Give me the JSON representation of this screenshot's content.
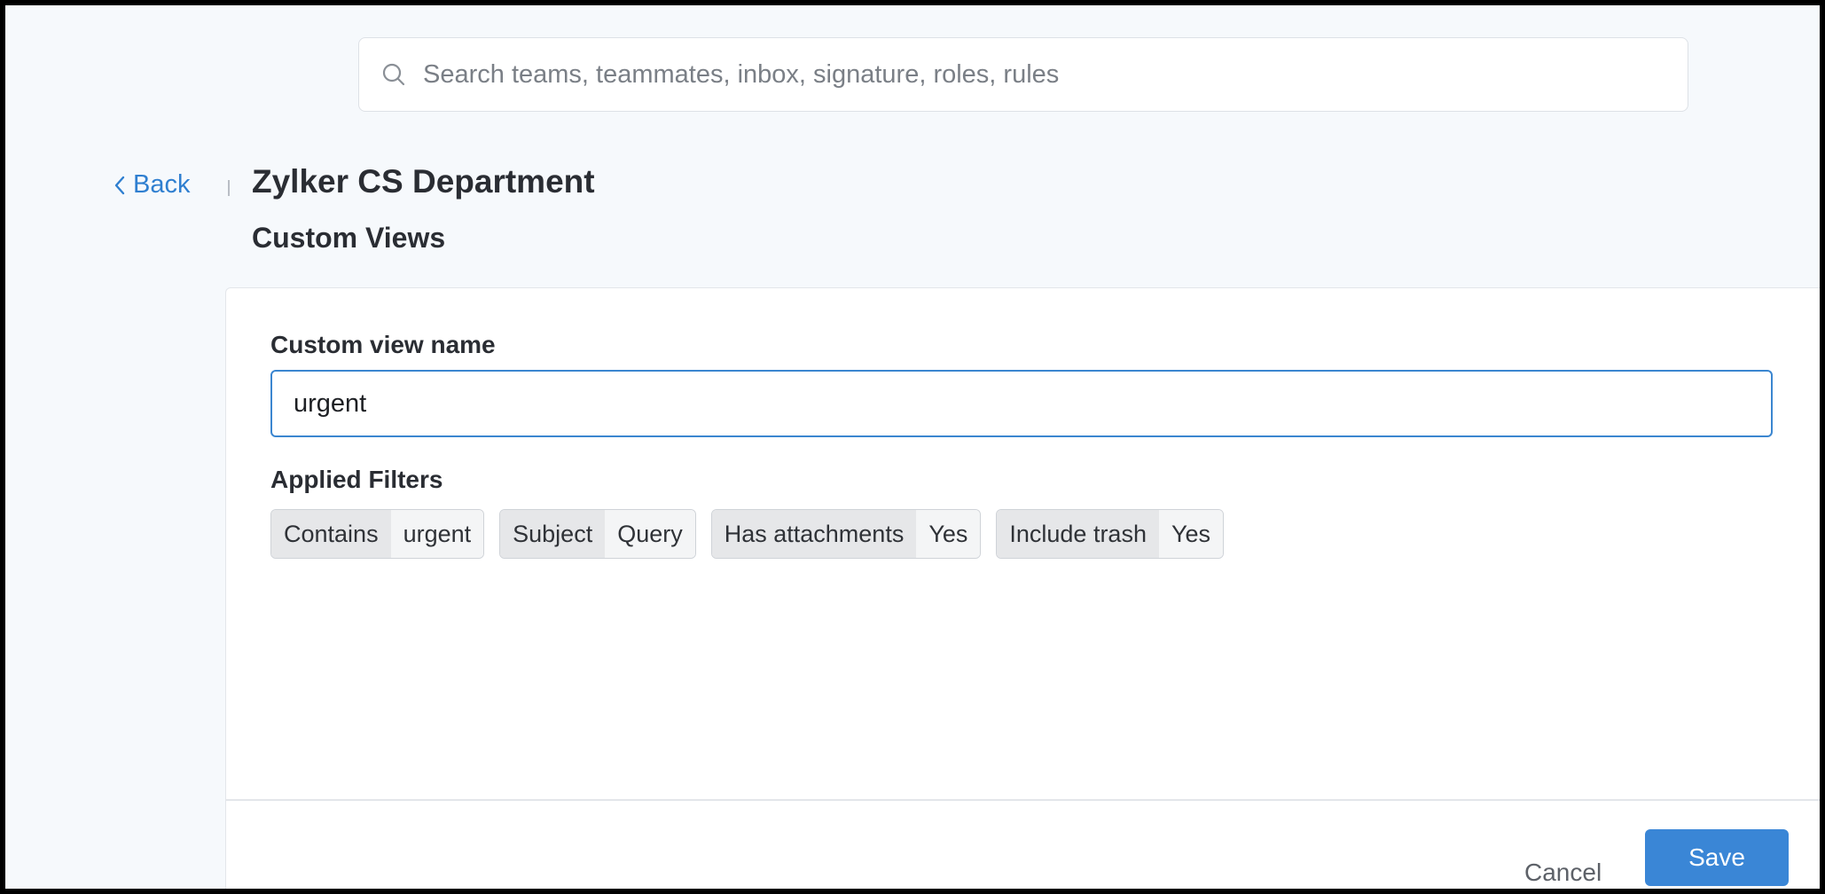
{
  "search": {
    "placeholder": "Search teams, teammates, inbox, signature, roles, rules"
  },
  "header": {
    "back_label": "Back",
    "title": "Zylker CS Department",
    "section_title": "Custom Views"
  },
  "form": {
    "name_label": "Custom view name",
    "name_value": "urgent",
    "filters_label": "Applied Filters",
    "filters": [
      {
        "key": "Contains",
        "value": "urgent"
      },
      {
        "key": "Subject",
        "value": "Query"
      },
      {
        "key": "Has attachments",
        "value": "Yes"
      },
      {
        "key": "Include trash",
        "value": "Yes"
      }
    ]
  },
  "footer": {
    "cancel_label": "Cancel",
    "save_label": "Save"
  },
  "colors": {
    "accent": "#3a86d6",
    "link": "#2f7fd0",
    "background": "#f6f9fc"
  },
  "icons": {
    "search": "search-icon",
    "back": "chevron-left-icon"
  }
}
